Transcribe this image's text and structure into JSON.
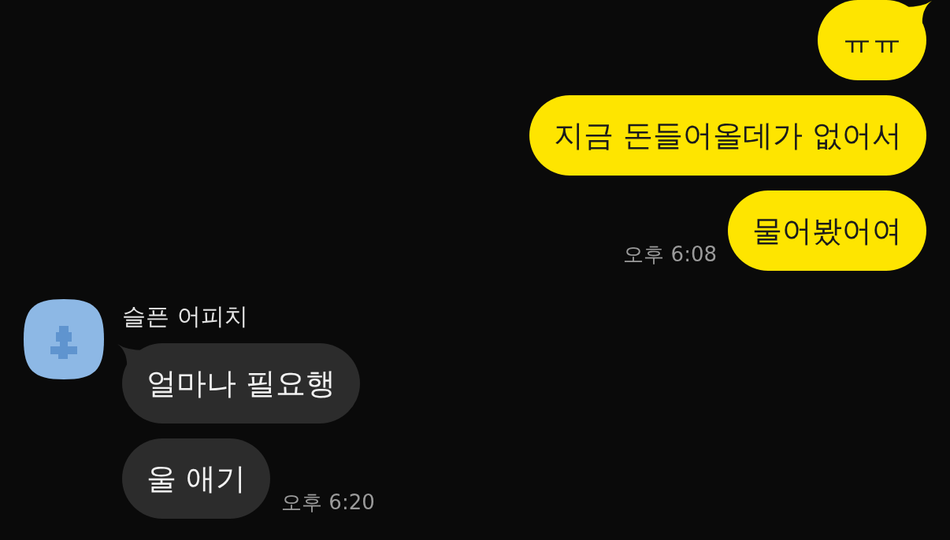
{
  "groups": [
    {
      "kind": "sent",
      "messages": [
        "ㅠㅠ",
        "지금 돈들어올데가 없어서",
        "물어봤어여"
      ],
      "time": "오후 6:08"
    },
    {
      "kind": "received",
      "sender": "슬픈 어피치",
      "messages": [
        "얼마나 필요행",
        "울 애기"
      ],
      "time": "오후 6:20"
    }
  ]
}
